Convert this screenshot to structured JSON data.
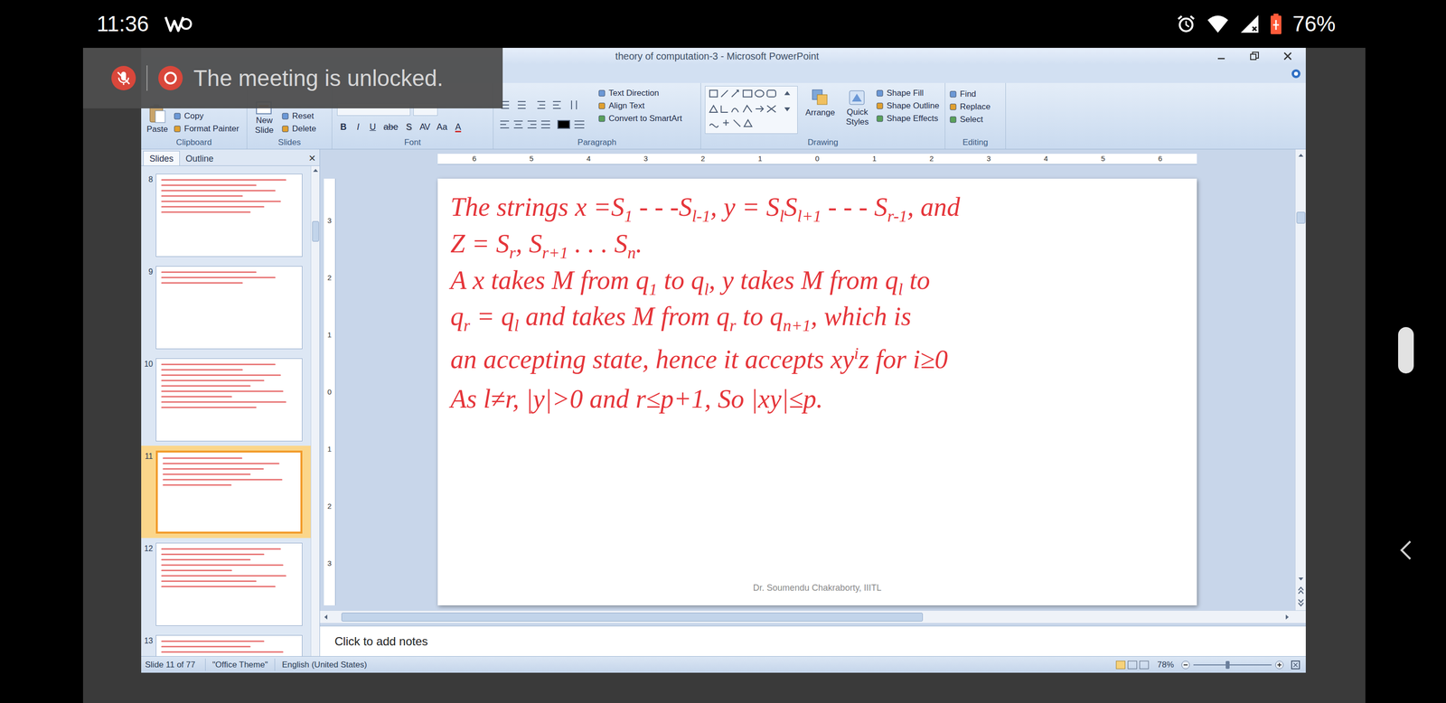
{
  "phone_status": {
    "time": "11:36",
    "battery": "76%"
  },
  "toast": {
    "message": "The meeting is unlocked."
  },
  "window": {
    "title": "theory of computation-3 - Microsoft PowerPoint"
  },
  "ribbon": {
    "clipboard": {
      "label": "Clipboard",
      "paste": "Paste",
      "buttons": [
        "Copy",
        "Format Painter"
      ]
    },
    "slides": {
      "label": "Slides",
      "new_slide": [
        "New",
        "Slide"
      ],
      "buttons": [
        "Reset",
        "Delete"
      ]
    },
    "font": {
      "label": "Font",
      "buttons": [
        "B",
        "I",
        "U",
        "abe",
        "S",
        "AV",
        "Aa",
        "A"
      ]
    },
    "paragraph": {
      "label": "Paragraph",
      "buttons": [
        "Text Direction",
        "Align Text",
        "Convert to SmartArt"
      ]
    },
    "drawing": {
      "label": "Drawing",
      "arrange": "Arrange",
      "quick_styles": [
        "Quick",
        "Styles"
      ],
      "buttons": [
        "Shape Fill",
        "Shape Outline",
        "Shape Effects"
      ]
    },
    "editing": {
      "label": "Editing",
      "buttons": [
        "Find",
        "Replace",
        "Select"
      ]
    }
  },
  "slide_pane": {
    "tabs": [
      {
        "label": "Slides",
        "selected": true
      },
      {
        "label": "Outline",
        "selected": false
      }
    ],
    "close": "×",
    "slides": [
      {
        "number": "8",
        "selected": false
      },
      {
        "number": "9",
        "selected": false
      },
      {
        "number": "10",
        "selected": false
      },
      {
        "number": "11",
        "selected": true
      },
      {
        "number": "12",
        "selected": false
      },
      {
        "number": "13",
        "selected": false
      }
    ]
  },
  "ruler": {
    "horizontal": [
      "6",
      "5",
      "4",
      "3",
      "2",
      "1",
      "0",
      "1",
      "2",
      "3",
      "4",
      "5",
      "6"
    ],
    "vertical": [
      "3",
      "2",
      "1",
      "0",
      "1",
      "2",
      "3"
    ]
  },
  "slide": {
    "lines": [
      [
        {
          "text": "The strings x =S",
          "kind": "text"
        },
        {
          "text": "1",
          "kind": "sub"
        },
        {
          "text": " - - -S",
          "kind": "text"
        },
        {
          "text": "l-1",
          "kind": "sub"
        },
        {
          "text": ", y = S",
          "kind": "text"
        },
        {
          "text": "l",
          "kind": "sub"
        },
        {
          "text": "S",
          "kind": "text"
        },
        {
          "text": "l+1",
          "kind": "sub"
        },
        {
          "text": " - - - S",
          "kind": "text"
        },
        {
          "text": "r-1",
          "kind": "sub"
        },
        {
          "text": ", and",
          "kind": "text"
        }
      ],
      [
        {
          "text": "Z = S",
          "kind": "text"
        },
        {
          "text": "r",
          "kind": "sub"
        },
        {
          "text": ", S",
          "kind": "text"
        },
        {
          "text": "r+1",
          "kind": "sub"
        },
        {
          "text": " . . . S",
          "kind": "text"
        },
        {
          "text": "n",
          "kind": "sub"
        },
        {
          "text": ".",
          "kind": "text"
        }
      ],
      [
        {
          "text": "A x takes M from q",
          "kind": "text"
        },
        {
          "text": "1",
          "kind": "sub"
        },
        {
          "text": " to q",
          "kind": "text"
        },
        {
          "text": "l",
          "kind": "sub"
        },
        {
          "text": ", y takes M from q",
          "kind": "text"
        },
        {
          "text": "l",
          "kind": "sub"
        },
        {
          "text": " to",
          "kind": "text"
        }
      ],
      [
        {
          "text": "q",
          "kind": "text"
        },
        {
          "text": "r",
          "kind": "sub"
        },
        {
          "text": " = q",
          "kind": "text"
        },
        {
          "text": "l",
          "kind": "sub"
        },
        {
          "text": " and takes M from q",
          "kind": "text"
        },
        {
          "text": "r",
          "kind": "sub"
        },
        {
          "text": " to q",
          "kind": "text"
        },
        {
          "text": "n+1",
          "kind": "sub"
        },
        {
          "text": ", which is",
          "kind": "text"
        }
      ],
      [
        {
          "text": "an accepting state, hence it accepts xy",
          "kind": "text"
        },
        {
          "text": "i",
          "kind": "sup"
        },
        {
          "text": "z for i≥0",
          "kind": "text"
        }
      ],
      [
        {
          "text": "As l≠r, |y|>0 and r≤p+1, So |xy|≤p.",
          "kind": "text"
        }
      ]
    ],
    "footer": "Dr. Soumendu Chakraborty, IIITL"
  },
  "notes": {
    "text": "Click to add notes"
  },
  "app_status": {
    "slide": "Slide 11 of 77",
    "theme": "\"Office Theme\"",
    "language": "English (United States)",
    "zoom": "78%"
  }
}
